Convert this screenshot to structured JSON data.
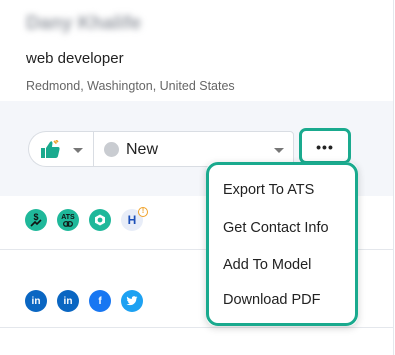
{
  "profile": {
    "name": "Dany Khalife",
    "title": "web developer",
    "location": "Redmond, Washington, United States"
  },
  "actions": {
    "rating_icon": "thumbs-up-icon",
    "status": {
      "selected": "New"
    },
    "more_label": "•••"
  },
  "badges": [
    {
      "icon": "dollar-trend-icon"
    },
    {
      "icon": "ats-icon",
      "label": "ATS"
    },
    {
      "icon": "hexagon-icon"
    },
    {
      "icon": "h-icon",
      "label": "H",
      "notice": "!"
    }
  ],
  "social": [
    {
      "icon": "linkedin-icon",
      "label": "in"
    },
    {
      "icon": "linkedin-icon",
      "label": "in"
    },
    {
      "icon": "facebook-icon",
      "label": "f"
    },
    {
      "icon": "twitter-icon",
      "label": "t"
    }
  ],
  "menu": {
    "items": [
      {
        "label": "Export To ATS"
      },
      {
        "label": "Get Contact Info"
      },
      {
        "label": "Add To Model"
      },
      {
        "label": "Download PDF"
      }
    ]
  },
  "colors": {
    "accent": "#1aaa8e",
    "badge_green": "#1fb89a",
    "linkedin": "#0a66c2",
    "facebook": "#1877f2",
    "twitter": "#1da1f2",
    "band_background": "#f4f6fa"
  }
}
